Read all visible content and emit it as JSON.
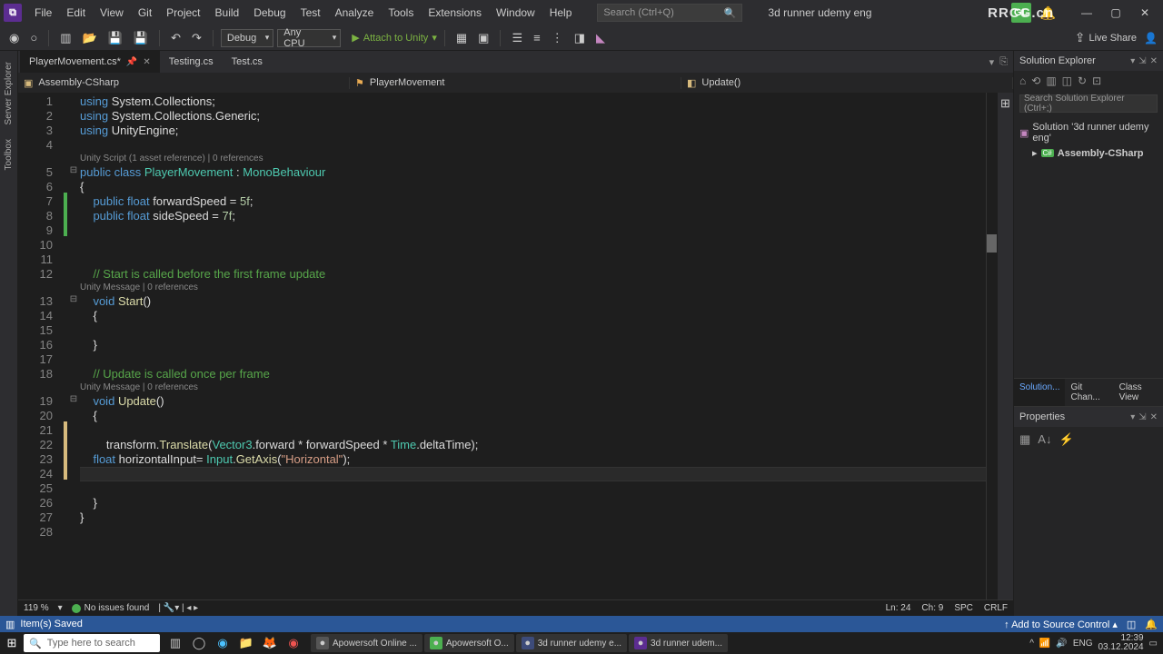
{
  "watermark": "RRCG.cn",
  "title": {
    "project": "3d runner udemy eng",
    "search_placeholder": "Search (Ctrl+Q)"
  },
  "menu": [
    "File",
    "Edit",
    "View",
    "Git",
    "Project",
    "Build",
    "Debug",
    "Test",
    "Analyze",
    "Tools",
    "Extensions",
    "Window",
    "Help"
  ],
  "user_badge": "GL",
  "toolbar": {
    "config": "Debug",
    "platform": "Any CPU",
    "attach": "Attach to Unity"
  },
  "live_share": "Live Share",
  "tabs": [
    {
      "label": "PlayerMovement.cs*",
      "active": true,
      "pinned": true
    },
    {
      "label": "Testing.cs"
    },
    {
      "label": "Test.cs"
    }
  ],
  "nav": {
    "project": "Assembly-CSharp",
    "class": "PlayerMovement",
    "member": "Update()"
  },
  "code": {
    "lines": [
      {
        "n": 1,
        "html": "<span class='kw'>using</span> <span class='pln'>System.Collections;</span>"
      },
      {
        "n": 2,
        "html": "<span class='kw'>using</span> <span class='pln'>System.Collections.Generic;</span>"
      },
      {
        "n": 3,
        "html": "<span class='kw'>using</span> <span class='pln'>UnityEngine;</span>"
      },
      {
        "n": 4,
        "html": ""
      },
      {
        "annot": true,
        "html": "    Unity Script (1 asset reference) | 0 references"
      },
      {
        "n": 5,
        "html": "<span class='kw'>public</span> <span class='kw'>class</span> <span class='cls'>PlayerMovement</span> <span class='pln'>:</span> <span class='cls'>MonoBehaviour</span>",
        "fold": "⊟"
      },
      {
        "n": 6,
        "html": "<span class='pln'>{</span>"
      },
      {
        "n": 7,
        "html": "    <span class='kw'>public</span> <span class='kw'>float</span> <span class='pln'>forwardSpeed = </span><span class='num'>5f</span><span class='pln'>;</span>",
        "change": "green"
      },
      {
        "n": 8,
        "html": "    <span class='kw'>public</span> <span class='kw'>float</span> <span class='pln'>sideSpeed = </span><span class='num'>7f</span><span class='pln'>;</span>",
        "change": "green"
      },
      {
        "n": 9,
        "html": "",
        "change": "green"
      },
      {
        "n": 10,
        "html": ""
      },
      {
        "n": 11,
        "html": ""
      },
      {
        "n": 12,
        "html": "    <span class='com'>// Start is called before the first frame update</span>"
      },
      {
        "annot": true,
        "html": "       Unity Message | 0 references"
      },
      {
        "n": 13,
        "html": "    <span class='kw'>void</span> <span class='mth'>Start</span><span class='pln'>()</span>",
        "fold": "⊟"
      },
      {
        "n": 14,
        "html": "    <span class='pln'>{</span>"
      },
      {
        "n": 15,
        "html": ""
      },
      {
        "n": 16,
        "html": "    <span class='pln'>}</span>"
      },
      {
        "n": 17,
        "html": ""
      },
      {
        "n": 18,
        "html": "    <span class='com'>// Update is called once per frame</span>"
      },
      {
        "annot": true,
        "html": "       Unity Message | 0 references"
      },
      {
        "n": 19,
        "html": "    <span class='kw'>void</span> <span class='mth'>Update</span><span class='pln'>()</span>",
        "fold": "⊟"
      },
      {
        "n": 20,
        "html": "    <span class='pln'>{</span>"
      },
      {
        "n": 21,
        "html": "",
        "change": "yellow"
      },
      {
        "n": 22,
        "html": "        <span class='pln'>transform.</span><span class='mth'>Translate</span><span class='pln'>(</span><span class='cls'>Vector3</span><span class='pln'>.forward * forwardSpeed * </span><span class='cls'>Time</span><span class='pln'>.deltaTime);</span>",
        "change": "yellow"
      },
      {
        "n": 23,
        "html": "    <span class='kw'>float</span> <span class='pln'>horizontalInput= </span><span class='cls'>Input</span><span class='pln'>.</span><span class='mth'>GetAxis</span><span class='pln'>(</span><span class='str'>\"Horizontal\"</span><span class='pln'>);</span>",
        "change": "yellow"
      },
      {
        "n": 24,
        "html": "        ",
        "change": "yellow",
        "current": true
      },
      {
        "n": 25,
        "html": ""
      },
      {
        "n": 26,
        "html": "    <span class='pln'>}</span>"
      },
      {
        "n": 27,
        "html": "<span class='pln'>}</span>"
      },
      {
        "n": 28,
        "html": ""
      }
    ]
  },
  "editor_status": {
    "zoom": "119 %",
    "issues": "No issues found",
    "ln": "Ln: 24",
    "ch": "Ch: 9",
    "spc": "SPC",
    "crlf": "CRLF"
  },
  "solution": {
    "title": "Solution Explorer",
    "search_placeholder": "Search Solution Explorer (Ctrl+;)",
    "root": "Solution '3d runner udemy eng'",
    "project": "Assembly-CSharp",
    "tabs": [
      "Solution...",
      "Git Chan...",
      "Class View"
    ]
  },
  "properties": {
    "title": "Properties"
  },
  "bluebar": {
    "saved": "Item(s) Saved",
    "source_control": "Add to Source Control"
  },
  "taskbar": {
    "search_placeholder": "Type here to search",
    "entries": [
      {
        "label": "Apowersoft Online ...",
        "color": "#555"
      },
      {
        "label": "Apowersoft O...",
        "color": "#4caf50"
      },
      {
        "label": "3d runner udemy e...",
        "color": "#3d4b7a"
      },
      {
        "label": "3d runner udem...",
        "color": "#5c2d91"
      }
    ],
    "time": "12:39",
    "date": "03.12.2024"
  }
}
